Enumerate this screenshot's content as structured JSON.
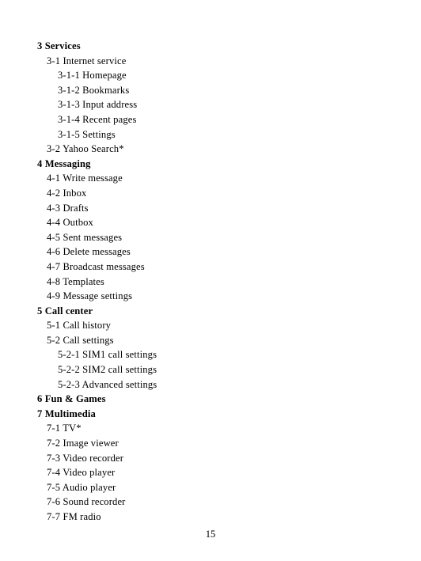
{
  "page": {
    "page_number": "15",
    "background_color": "#ffffff",
    "text_color": "#000000"
  },
  "toc": {
    "entries": [
      {
        "level": 1,
        "text": "3 Services"
      },
      {
        "level": 2,
        "text": "3-1 Internet service"
      },
      {
        "level": 3,
        "text": "3-1-1 Homepage"
      },
      {
        "level": 3,
        "text": "3-1-2 Bookmarks"
      },
      {
        "level": 3,
        "text": "3-1-3 Input address"
      },
      {
        "level": 3,
        "text": "3-1-4 Recent pages"
      },
      {
        "level": 3,
        "text": "3-1-5 Settings"
      },
      {
        "level": 2,
        "text": "3-2 Yahoo Search*"
      },
      {
        "level": 1,
        "text": "4 Messaging"
      },
      {
        "level": 2,
        "text": "4-1 Write message"
      },
      {
        "level": 2,
        "text": "4-2 Inbox"
      },
      {
        "level": 2,
        "text": "4-3 Drafts"
      },
      {
        "level": 2,
        "text": "4-4 Outbox"
      },
      {
        "level": 2,
        "text": "4-5 Sent messages"
      },
      {
        "level": 2,
        "text": "4-6 Delete messages"
      },
      {
        "level": 2,
        "text": "4-7 Broadcast messages"
      },
      {
        "level": 2,
        "text": "4-8 Templates"
      },
      {
        "level": 2,
        "text": "4-9 Message settings"
      },
      {
        "level": 1,
        "text": "5 Call center"
      },
      {
        "level": 2,
        "text": "5-1 Call history"
      },
      {
        "level": 2,
        "text": "5-2 Call settings"
      },
      {
        "level": 3,
        "text": "5-2-1 SIM1 call settings"
      },
      {
        "level": 3,
        "text": "5-2-2 SIM2 call settings"
      },
      {
        "level": 3,
        "text": "5-2-3 Advanced settings"
      },
      {
        "level": 1,
        "text": "6 Fun & Games"
      },
      {
        "level": 1,
        "text": "7 Multimedia"
      },
      {
        "level": 2,
        "text": "7-1 TV*"
      },
      {
        "level": 2,
        "text": "7-2 Image viewer"
      },
      {
        "level": 2,
        "text": "7-3 Video recorder"
      },
      {
        "level": 2,
        "text": "7-4 Video player"
      },
      {
        "level": 2,
        "text": "7-5 Audio player"
      },
      {
        "level": 2,
        "text": "7-6 Sound recorder"
      },
      {
        "level": 2,
        "text": "7-7 FM radio"
      }
    ]
  }
}
